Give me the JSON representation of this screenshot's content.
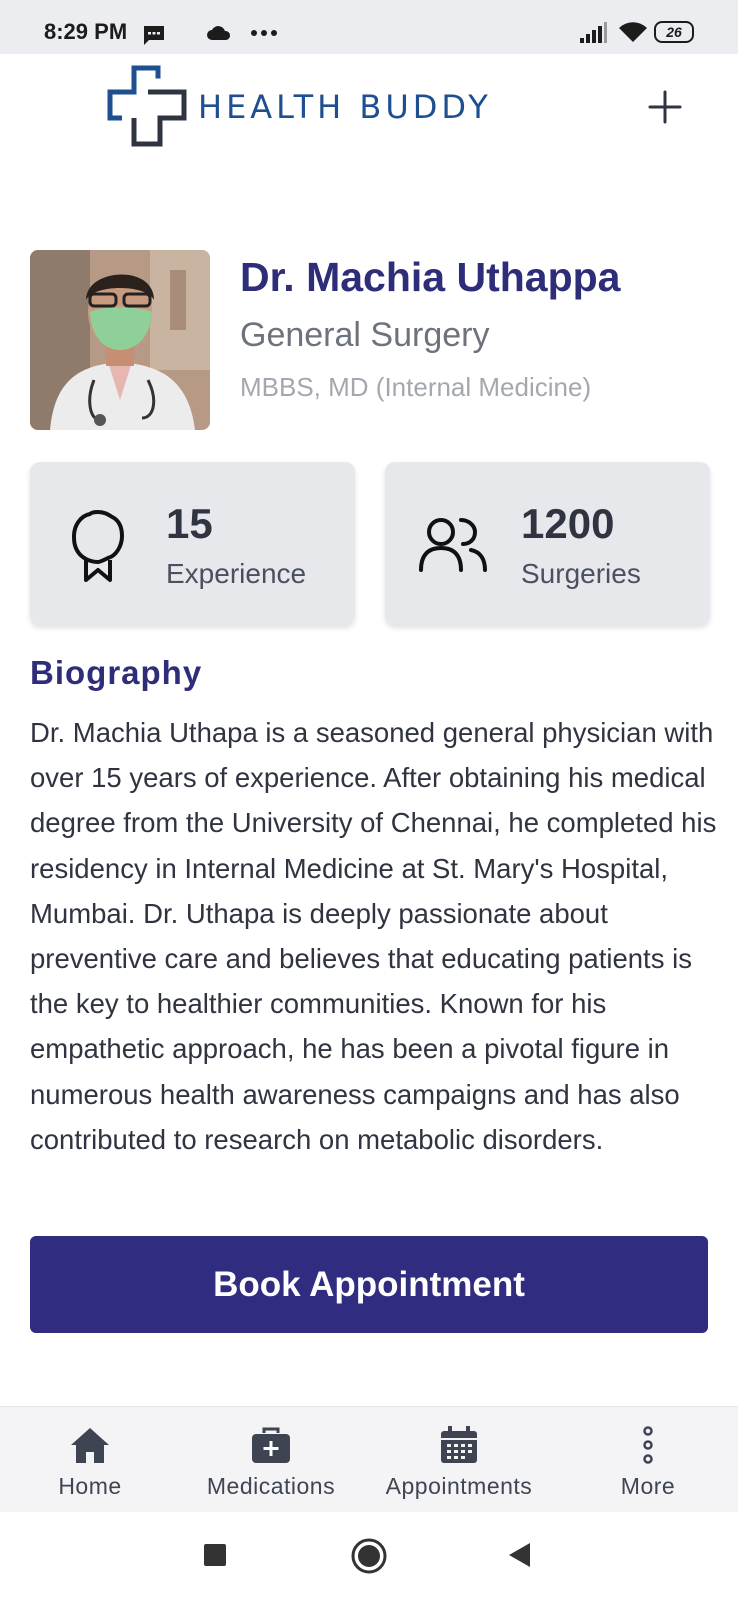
{
  "status_bar": {
    "time": "8:29 PM",
    "battery": "26",
    "icons": [
      "message-icon",
      "cloud-icon",
      "more-dots-icon",
      "signal-icon",
      "wifi-icon",
      "battery-icon"
    ]
  },
  "header": {
    "logo_text": "HEALTH BUDDY",
    "logo_icon": "medical-cross-logo-icon",
    "add_icon": "plus-icon"
  },
  "doctor": {
    "name": "Dr. Machia Uthappa",
    "specialty": "General Surgery",
    "qualification": "MBBS, MD (Internal Medicine)"
  },
  "stats": [
    {
      "value": "15",
      "label": "Experience",
      "icon": "award-ribbon-icon"
    },
    {
      "value": "1200",
      "label": "Surgeries",
      "icon": "users-icon"
    }
  ],
  "biography": {
    "heading": "Biography",
    "text": "Dr. Machia Uthapa is a seasoned general physician with over 15 years of experience. After obtaining his medical degree from the University of Chennai, he completed his residency in Internal Medicine at St. Mary's Hospital, Mumbai. Dr. Uthapa is deeply passionate about preventive care and believes that educating patients is the key to healthier communities. Known for his empathetic approach, he has been a pivotal figure in numerous health awareness campaigns and has also contributed to research on metabolic disorders."
  },
  "actions": {
    "book_label": "Book Appointment"
  },
  "bottom_nav": {
    "items": [
      {
        "label": "Home",
        "icon": "home-icon"
      },
      {
        "label": "Medications",
        "icon": "medical-bag-icon"
      },
      {
        "label": "Appointments",
        "icon": "calendar-icon"
      },
      {
        "label": "More",
        "icon": "more-vertical-icon"
      }
    ]
  },
  "colors": {
    "primary": "#302c80",
    "heading": "#2e2d7a",
    "logo": "#1e4f90",
    "card_bg": "#e7e8ec"
  }
}
